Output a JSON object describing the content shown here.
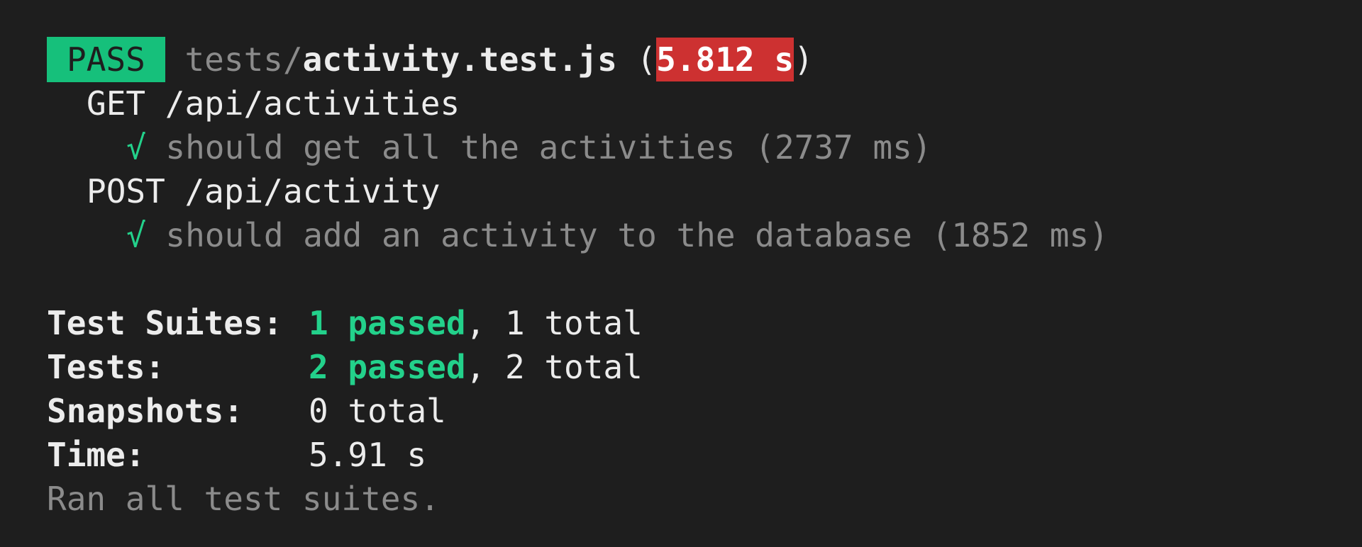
{
  "header": {
    "status_badge": "PASS",
    "path_dir": "tests/",
    "path_file": "activity.test.js",
    "open_paren": " (",
    "duration": "5.812 s",
    "close_paren": ")"
  },
  "describe_blocks": [
    {
      "title": "GET /api/activities",
      "tests": [
        {
          "check": "√",
          "name": "should get all the activities",
          "duration": "(2737 ms)"
        }
      ]
    },
    {
      "title": "POST /api/activity",
      "tests": [
        {
          "check": "√",
          "name": "should add an activity to the database",
          "duration": "(1852 ms)"
        }
      ]
    }
  ],
  "summary": {
    "suites": {
      "label": "Test Suites:",
      "passed": "1 passed",
      "sep": ", ",
      "total": "1 total"
    },
    "tests": {
      "label": "Tests:",
      "passed": "2 passed",
      "sep": ", ",
      "total": "2 total"
    },
    "snapshots": {
      "label": "Snapshots:",
      "total": "0 total"
    },
    "time": {
      "label": "Time:",
      "value": "5.91 s"
    },
    "footer": "Ran all test suites."
  },
  "colors": {
    "background": "#1e1e1e",
    "pass_badge": "#16c07b",
    "slow_duration": "#cd3131",
    "passed_text": "#23d18b",
    "dim_text": "#8b8b8b"
  }
}
